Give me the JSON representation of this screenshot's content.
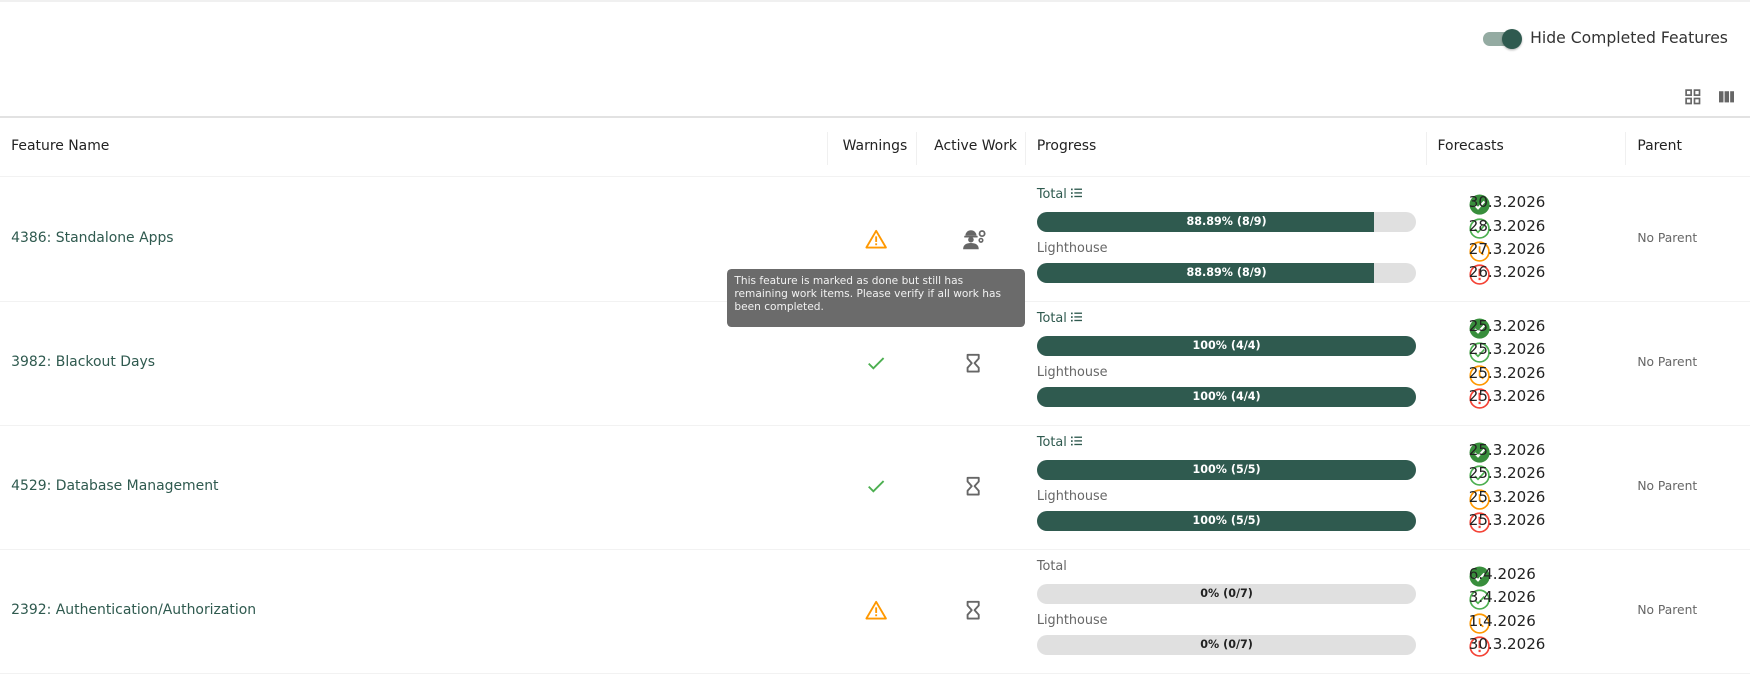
{
  "toolbar": {
    "hide_completed_label": "Hide Completed Features",
    "hide_completed_on": true
  },
  "table": {
    "headers": [
      "Feature Name",
      "Warnings",
      "Active Work",
      "Progress",
      "Forecasts",
      "Parent"
    ],
    "rows": [
      {
        "name": "4386: Standalone Apps",
        "warning": "warning",
        "active": "worker",
        "total_label": "Total",
        "total_link": true,
        "total_text": "88.89% (8/9)",
        "total_pct": 88.89,
        "lh_label": "Lighthouse",
        "lh_text": "88.89% (8/9)",
        "lh_pct": 88.89,
        "forecasts": [
          "30.3.2026",
          "28.3.2026",
          "27.3.2026",
          "26.3.2026"
        ],
        "parent": "No Parent"
      },
      {
        "name": "3982: Blackout Days",
        "warning": "ok",
        "active": "hourglass",
        "total_label": "Total",
        "total_link": true,
        "total_text": "100% (4/4)",
        "total_pct": 100,
        "lh_label": "Lighthouse",
        "lh_text": "100% (4/4)",
        "lh_pct": 100,
        "forecasts": [
          "25.3.2026",
          "25.3.2026",
          "25.3.2026",
          "25.3.2026"
        ],
        "parent": "No Parent"
      },
      {
        "name": "4529: Database Management",
        "warning": "ok",
        "active": "hourglass",
        "total_label": "Total",
        "total_link": true,
        "total_text": "100% (5/5)",
        "total_pct": 100,
        "lh_label": "Lighthouse",
        "lh_text": "100% (5/5)",
        "lh_pct": 100,
        "forecasts": [
          "25.3.2026",
          "25.3.2026",
          "25.3.2026",
          "25.3.2026"
        ],
        "parent": "No Parent"
      },
      {
        "name": "2392: Authentication/Authorization",
        "warning": "warning",
        "active": "hourglass",
        "total_label": "Total",
        "total_link": false,
        "total_text": "0% (0/7)",
        "total_pct": 0,
        "lh_label": "Lighthouse",
        "lh_text": "0% (0/7)",
        "lh_pct": 0,
        "forecasts": [
          "6.4.2026",
          "3.4.2026",
          "1.4.2026",
          "30.3.2026"
        ],
        "parent": "No Parent"
      }
    ]
  },
  "tooltip": "This feature is marked as done but still has remaining work items. Please verify if all work has been completed.",
  "colors": {
    "accent": "#2f5a4f",
    "warning": "#ff9800",
    "ok": "#4caf50",
    "forecast": [
      "#388e3c",
      "#4caf50",
      "#ff9800",
      "#f44336"
    ]
  }
}
